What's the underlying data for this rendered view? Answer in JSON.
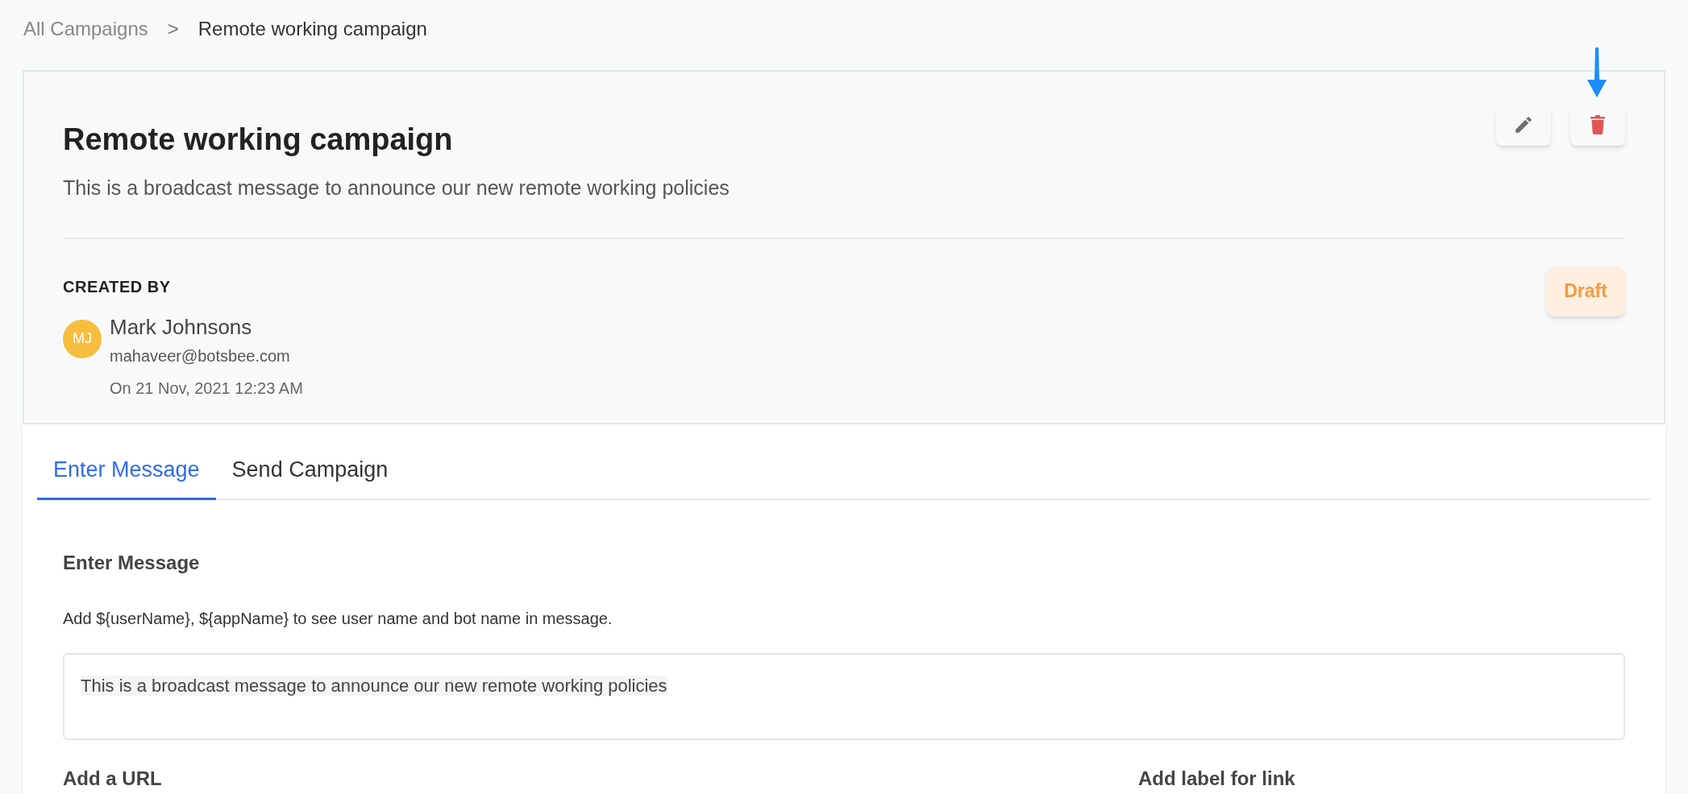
{
  "breadcrumb": {
    "items": [
      "All Campaigns",
      "Remote working campaign"
    ],
    "separator": ">"
  },
  "campaign": {
    "title": "Remote working campaign",
    "description": "This is a broadcast message to announce our new remote working policies",
    "created_by_label": "CREATED BY",
    "creator": {
      "initials": "MJ",
      "name": "Mark Johnsons",
      "email": "mahaveer@botsbee.com",
      "date": "On 21 Nov, 2021 12:23 AM"
    },
    "status": "Draft"
  },
  "tabs": [
    {
      "label": "Enter Message",
      "selected": true
    },
    {
      "label": "Send Campaign",
      "selected": false
    }
  ],
  "form": {
    "heading": "Enter Message",
    "hint": "Add ${userName}, ${appName} to see user name and bot name in message.",
    "message": "This is a broadcast message to announce our new remote working policies",
    "url_label": "Add a URL",
    "link_label": "Add label for link"
  }
}
